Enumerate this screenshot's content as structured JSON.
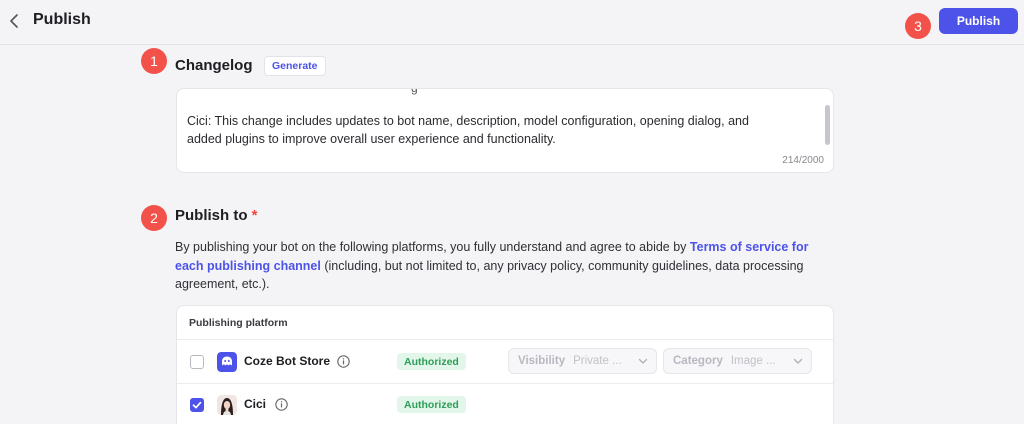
{
  "header": {
    "title": "Publish",
    "publish_label": "Publish"
  },
  "badges": [
    "1",
    "2",
    "3"
  ],
  "changelog": {
    "title": "Changelog",
    "generate_label": "Generate",
    "text": "Cici: This change includes updates to bot name, description, model configuration, opening dialog, and added plugins to improve overall user experience and functionality.",
    "counter": "214/2000"
  },
  "publish_to": {
    "title": "Publish to",
    "required_mark": "*",
    "desc_before": "By publishing your bot on the following platforms, you fully understand and agree to abide by ",
    "desc_link": "Terms of service for each publishing channel",
    "desc_after": " (including, but not limited to, any privacy policy, community guidelines, data processing agreement, etc.)."
  },
  "table": {
    "header": "Publishing platform",
    "rows": [
      {
        "name": "Coze Bot Store",
        "status": "Authorized",
        "checked": false,
        "visibility_label": "Visibility",
        "visibility_value": "Private ...",
        "category_label": "Category",
        "category_value": "Image ..."
      },
      {
        "name": "Cici",
        "status": "Authorized",
        "checked": true
      }
    ]
  },
  "colors": {
    "accent": "#4d53e8",
    "badge": "#f2524a",
    "authorized_bg": "#e3f6ea",
    "authorized_text": "#2f9e5a"
  }
}
